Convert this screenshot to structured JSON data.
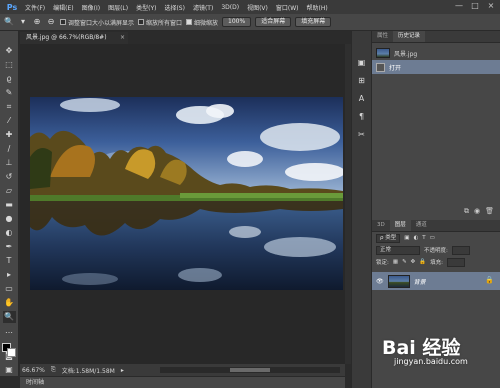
{
  "app": {
    "logo": "Ps"
  },
  "menu": [
    "文件(F)",
    "编辑(E)",
    "图像(I)",
    "图层(L)",
    "类型(Y)",
    "选择(S)",
    "滤镜(T)",
    "3D(D)",
    "视图(V)",
    "窗口(W)",
    "帮助(H)"
  ],
  "window_controls": [
    "—",
    "□",
    "×"
  ],
  "options": {
    "resize_windows": "调整窗口大小以满屏显示",
    "zoom_all": "缩放所有窗口",
    "scrubby_zoom": "细微缩放",
    "zoom_100": "100%",
    "fit_screen": "适合屏幕",
    "fill_screen": "填充屏幕"
  },
  "document": {
    "tab_title": "风景.jpg @ 66.7%(RGB/8#)",
    "close": "×"
  },
  "status": {
    "zoom": "66.67%",
    "doc_size": "文档:1.58M/1.58M",
    "arrow": "▸"
  },
  "timeline": {
    "label": "时间轴"
  },
  "history_panel": {
    "tabs": [
      "属性",
      "历史记录"
    ],
    "snapshot_name": "风景.jpg",
    "items": [
      {
        "label": "打开"
      }
    ]
  },
  "layers_panel": {
    "tabs": [
      "3D",
      "图层",
      "通道"
    ],
    "kind_filter": "ρ 类型",
    "blend_mode": "正常",
    "opacity_label": "不透明度:",
    "lock_label": "锁定:",
    "fill_label": "填充:",
    "layers": [
      {
        "name": "背景"
      }
    ]
  },
  "watermark": {
    "text": "Bai 经验",
    "url": "jingyan.baidu.com"
  }
}
